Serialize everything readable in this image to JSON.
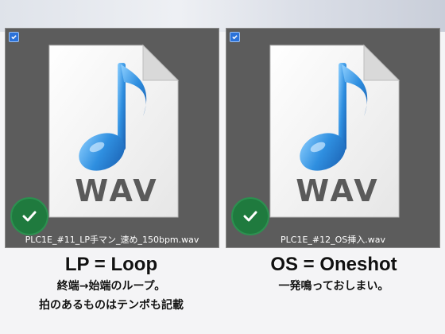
{
  "files": [
    {
      "filename": "PLC1E_#11_LP手マン_速め_150bpm.wav",
      "icon_label": "WAV",
      "selected": true,
      "status_icon": "check-circle-icon",
      "file_icon": "music-note-icon",
      "caption_title": "LP = Loop",
      "caption_lines": [
        "終端→始端のループ。",
        "拍のあるものはテンポも記載"
      ]
    },
    {
      "filename": "PLC1E_#12_OS挿入.wav",
      "icon_label": "WAV",
      "selected": true,
      "status_icon": "check-circle-icon",
      "file_icon": "music-note-icon",
      "caption_title": "OS = Oneshot",
      "caption_lines": [
        "一発鳴っておしまい。"
      ]
    }
  ],
  "colors": {
    "tile_bg": "#5c5c5c",
    "check_green": "#1f7a3e",
    "note_blue": "#2f8fe0",
    "wav_text": "#5a5a5a"
  }
}
